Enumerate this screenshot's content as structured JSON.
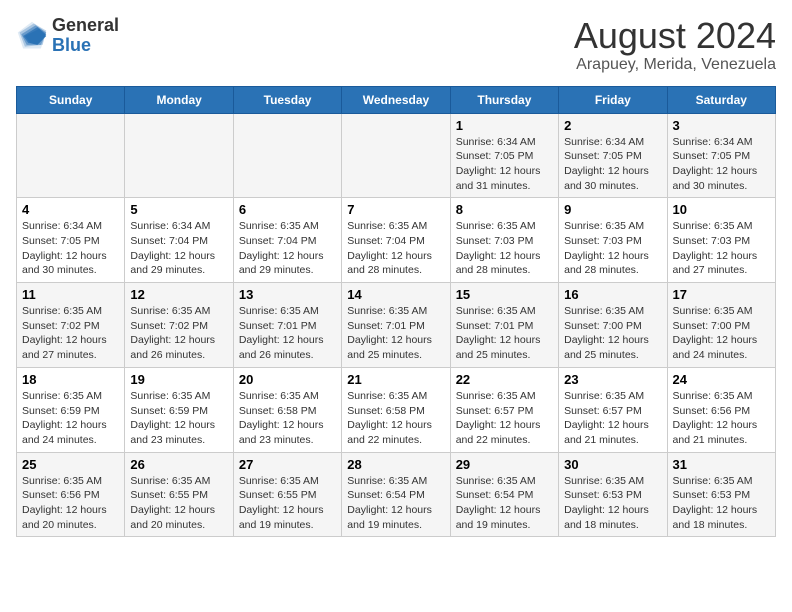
{
  "logo": {
    "general": "General",
    "blue": "Blue"
  },
  "title": "August 2024",
  "subtitle": "Arapuey, Merida, Venezuela",
  "headers": [
    "Sunday",
    "Monday",
    "Tuesday",
    "Wednesday",
    "Thursday",
    "Friday",
    "Saturday"
  ],
  "weeks": [
    [
      {
        "day": "",
        "info": ""
      },
      {
        "day": "",
        "info": ""
      },
      {
        "day": "",
        "info": ""
      },
      {
        "day": "",
        "info": ""
      },
      {
        "day": "1",
        "info": "Sunrise: 6:34 AM\nSunset: 7:05 PM\nDaylight: 12 hours\nand 31 minutes."
      },
      {
        "day": "2",
        "info": "Sunrise: 6:34 AM\nSunset: 7:05 PM\nDaylight: 12 hours\nand 30 minutes."
      },
      {
        "day": "3",
        "info": "Sunrise: 6:34 AM\nSunset: 7:05 PM\nDaylight: 12 hours\nand 30 minutes."
      }
    ],
    [
      {
        "day": "4",
        "info": "Sunrise: 6:34 AM\nSunset: 7:05 PM\nDaylight: 12 hours\nand 30 minutes."
      },
      {
        "day": "5",
        "info": "Sunrise: 6:34 AM\nSunset: 7:04 PM\nDaylight: 12 hours\nand 29 minutes."
      },
      {
        "day": "6",
        "info": "Sunrise: 6:35 AM\nSunset: 7:04 PM\nDaylight: 12 hours\nand 29 minutes."
      },
      {
        "day": "7",
        "info": "Sunrise: 6:35 AM\nSunset: 7:04 PM\nDaylight: 12 hours\nand 28 minutes."
      },
      {
        "day": "8",
        "info": "Sunrise: 6:35 AM\nSunset: 7:03 PM\nDaylight: 12 hours\nand 28 minutes."
      },
      {
        "day": "9",
        "info": "Sunrise: 6:35 AM\nSunset: 7:03 PM\nDaylight: 12 hours\nand 28 minutes."
      },
      {
        "day": "10",
        "info": "Sunrise: 6:35 AM\nSunset: 7:03 PM\nDaylight: 12 hours\nand 27 minutes."
      }
    ],
    [
      {
        "day": "11",
        "info": "Sunrise: 6:35 AM\nSunset: 7:02 PM\nDaylight: 12 hours\nand 27 minutes."
      },
      {
        "day": "12",
        "info": "Sunrise: 6:35 AM\nSunset: 7:02 PM\nDaylight: 12 hours\nand 26 minutes."
      },
      {
        "day": "13",
        "info": "Sunrise: 6:35 AM\nSunset: 7:01 PM\nDaylight: 12 hours\nand 26 minutes."
      },
      {
        "day": "14",
        "info": "Sunrise: 6:35 AM\nSunset: 7:01 PM\nDaylight: 12 hours\nand 25 minutes."
      },
      {
        "day": "15",
        "info": "Sunrise: 6:35 AM\nSunset: 7:01 PM\nDaylight: 12 hours\nand 25 minutes."
      },
      {
        "day": "16",
        "info": "Sunrise: 6:35 AM\nSunset: 7:00 PM\nDaylight: 12 hours\nand 25 minutes."
      },
      {
        "day": "17",
        "info": "Sunrise: 6:35 AM\nSunset: 7:00 PM\nDaylight: 12 hours\nand 24 minutes."
      }
    ],
    [
      {
        "day": "18",
        "info": "Sunrise: 6:35 AM\nSunset: 6:59 PM\nDaylight: 12 hours\nand 24 minutes."
      },
      {
        "day": "19",
        "info": "Sunrise: 6:35 AM\nSunset: 6:59 PM\nDaylight: 12 hours\nand 23 minutes."
      },
      {
        "day": "20",
        "info": "Sunrise: 6:35 AM\nSunset: 6:58 PM\nDaylight: 12 hours\nand 23 minutes."
      },
      {
        "day": "21",
        "info": "Sunrise: 6:35 AM\nSunset: 6:58 PM\nDaylight: 12 hours\nand 22 minutes."
      },
      {
        "day": "22",
        "info": "Sunrise: 6:35 AM\nSunset: 6:57 PM\nDaylight: 12 hours\nand 22 minutes."
      },
      {
        "day": "23",
        "info": "Sunrise: 6:35 AM\nSunset: 6:57 PM\nDaylight: 12 hours\nand 21 minutes."
      },
      {
        "day": "24",
        "info": "Sunrise: 6:35 AM\nSunset: 6:56 PM\nDaylight: 12 hours\nand 21 minutes."
      }
    ],
    [
      {
        "day": "25",
        "info": "Sunrise: 6:35 AM\nSunset: 6:56 PM\nDaylight: 12 hours\nand 20 minutes."
      },
      {
        "day": "26",
        "info": "Sunrise: 6:35 AM\nSunset: 6:55 PM\nDaylight: 12 hours\nand 20 minutes."
      },
      {
        "day": "27",
        "info": "Sunrise: 6:35 AM\nSunset: 6:55 PM\nDaylight: 12 hours\nand 19 minutes."
      },
      {
        "day": "28",
        "info": "Sunrise: 6:35 AM\nSunset: 6:54 PM\nDaylight: 12 hours\nand 19 minutes."
      },
      {
        "day": "29",
        "info": "Sunrise: 6:35 AM\nSunset: 6:54 PM\nDaylight: 12 hours\nand 19 minutes."
      },
      {
        "day": "30",
        "info": "Sunrise: 6:35 AM\nSunset: 6:53 PM\nDaylight: 12 hours\nand 18 minutes."
      },
      {
        "day": "31",
        "info": "Sunrise: 6:35 AM\nSunset: 6:53 PM\nDaylight: 12 hours\nand 18 minutes."
      }
    ]
  ]
}
